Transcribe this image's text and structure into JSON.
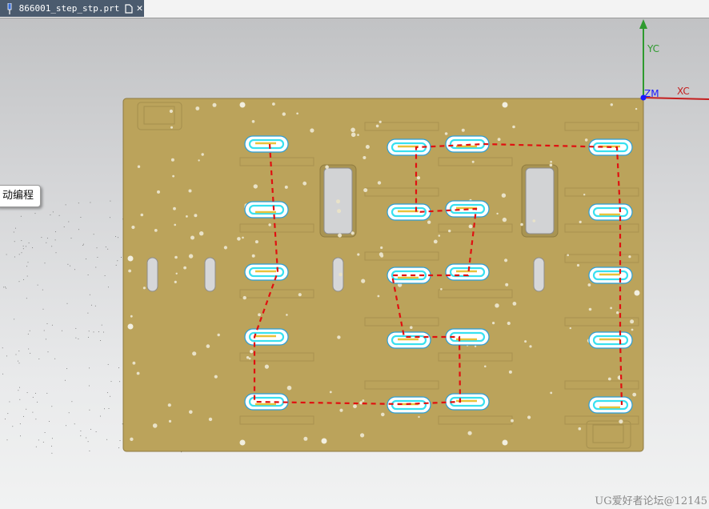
{
  "tab": {
    "title": "866001_step_stp.prt",
    "pin_icon": "pin-icon",
    "doc_icon": "document-icon",
    "close_icon": "close-icon"
  },
  "callout": {
    "text": "动编程"
  },
  "axes": {
    "y_label": "YC",
    "x_label": "XC",
    "z_label": "ZM",
    "y_color": "#2e9a2e",
    "x_color": "#c41e1e",
    "origin_color": "#1a1aff"
  },
  "plate": {
    "color": "#bba35b"
  },
  "slots": {
    "outline": "#2a9fd6",
    "fill": "#ffffff",
    "inner": "#38e0f0",
    "toolpath": "#e8c23a"
  },
  "route": {
    "color": "#e01010"
  },
  "watermark": "UG爱好者论坛@12145"
}
